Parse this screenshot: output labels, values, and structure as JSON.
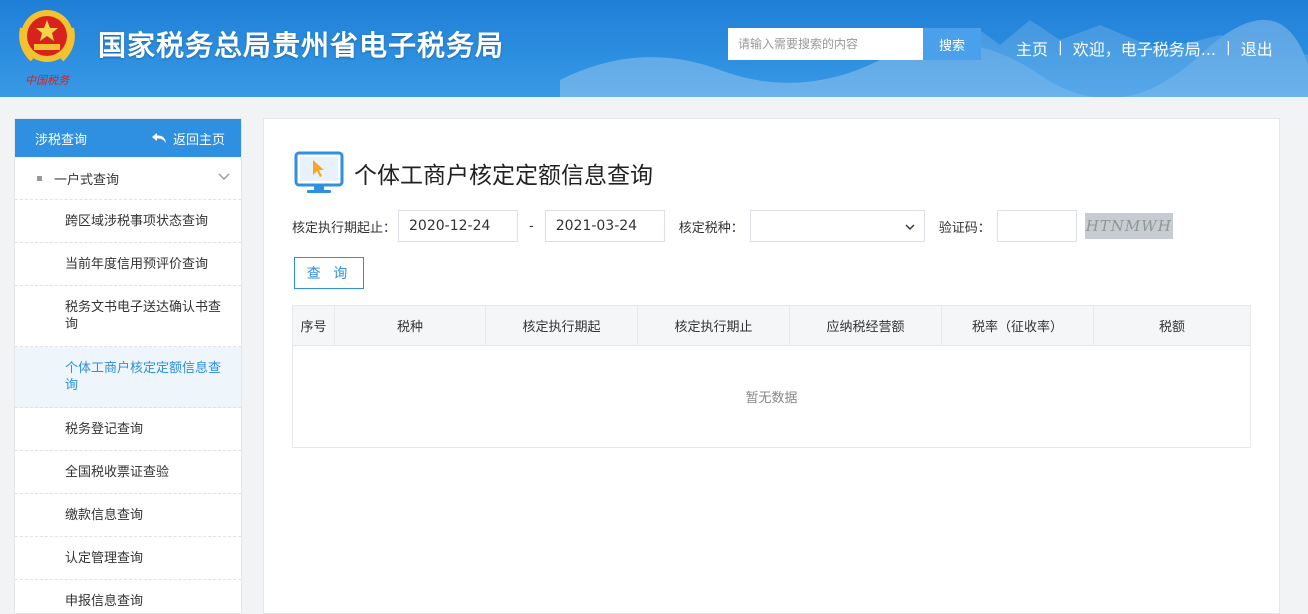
{
  "header": {
    "emblem_caption": "中国税务",
    "site_title": "国家税务总局贵州省电子税务局",
    "search_placeholder": "请输入需要搜索的内容",
    "search_button": "搜索",
    "nav": {
      "home": "主页",
      "sep1": "|",
      "welcome": "欢迎，电子税务局...",
      "sep2": "|",
      "logout": "退出"
    }
  },
  "sidebar": {
    "title": "涉税查询",
    "back_label": "返回主页",
    "group_label": "一户式查询",
    "items": [
      {
        "label": "跨区域涉税事项状态查询"
      },
      {
        "label": "当前年度信用预评价查询"
      },
      {
        "label": "税务文书电子送达确认书查询"
      },
      {
        "label": "个体工商户核定定额信息查询",
        "active": true
      },
      {
        "label": "税务登记查询"
      },
      {
        "label": "全国税收票证查验"
      },
      {
        "label": "缴款信息查询"
      },
      {
        "label": "认定管理查询"
      },
      {
        "label": "申报信息查询"
      }
    ]
  },
  "main": {
    "title": "个体工商户核定定额信息查询",
    "form": {
      "period_label": "核定执行期起止：",
      "start_date": "2020-12-24",
      "date_sep": "-",
      "end_date": "2021-03-24",
      "tax_type_label": "核定税种：",
      "tax_type_value": "",
      "captcha_label": "验证码：",
      "captcha_value": "",
      "captcha_image_text": "HTNMWH"
    },
    "query_button": "查 询",
    "table": {
      "columns": [
        "序号",
        "税种",
        "核定执行期起",
        "核定执行期止",
        "应纳税经营额",
        "税率（征收率）",
        "税额"
      ],
      "empty_text": "暂无数据"
    }
  },
  "colors": {
    "brand_blue": "#2f8fe0",
    "header_blue": "#2d8fe0",
    "active_bg": "#eef5fb"
  }
}
